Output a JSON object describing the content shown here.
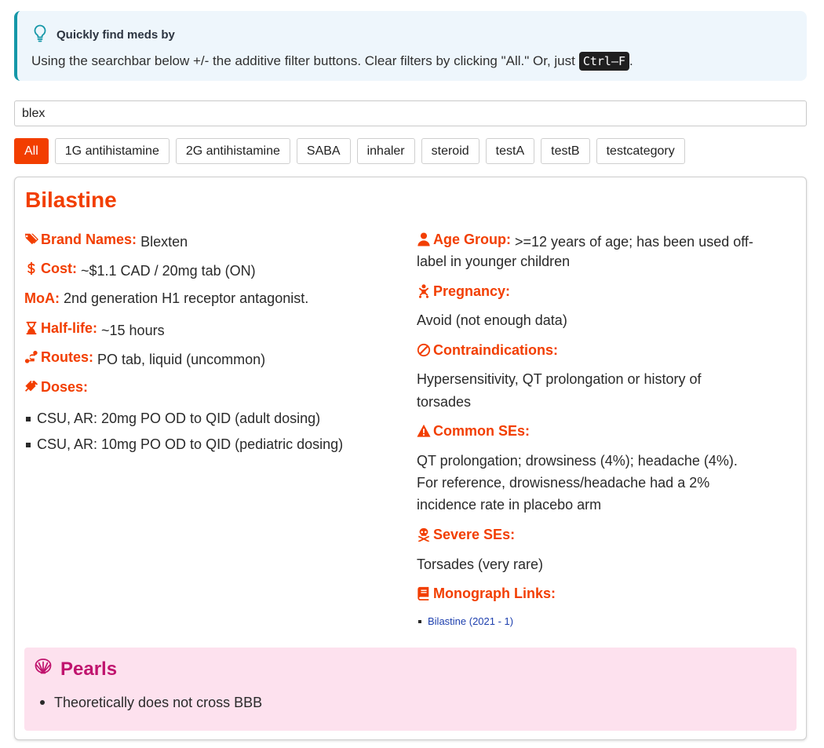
{
  "tip": {
    "title": "Quickly find meds by",
    "body": "Using the searchbar below +/- the additive filter buttons. Clear filters by clicking \"All.\" Or, just",
    "shortcut": "Ctrl–F",
    "end": ".",
    "accent": "#1597a8",
    "background": "#eef6fc"
  },
  "search": {
    "value": "blex"
  },
  "filters": [
    "All",
    "1G antihistamine",
    "2G antihistamine",
    "SABA",
    "inhaler",
    "steroid",
    "testA",
    "testB",
    "testcategory"
  ],
  "active_filter": "All",
  "drug": {
    "name": "Bilastine",
    "accent": "#f23e00",
    "brand_label": "Brand Names:",
    "brand_value": "Blexten",
    "cost_label": "Cost:",
    "cost_value": "~$1.1 CAD / 20mg tab (ON)",
    "moa_label": "MoA:",
    "moa_value": "2nd generation H1 receptor antagonist.",
    "halflife_label": "Half-life:",
    "halflife_value": "~15 hours",
    "routes_label": "Routes:",
    "routes_value": "PO tab, liquid (uncommon)",
    "doses_label": "Doses:",
    "doses": [
      "CSU, AR: 20mg PO OD to QID (adult dosing)",
      "CSU, AR: 10mg PO OD to QID (pediatric dosing)"
    ],
    "age_label": "Age Group:",
    "age_value_1": ">=12 years of age; has been used off-",
    "age_value_2": "label in younger children",
    "pregnancy_label": "Pregnancy:",
    "pregnancy_value": "Avoid (not enough data)",
    "contra_label": "Contraindications:",
    "contra_value_1": "Hypersensitivity, QT prolongation or history of",
    "contra_value_2": "torsades",
    "ses_label": "Common SEs:",
    "ses_value_1": "QT prolongation; drowsiness (4%); headache (4%).",
    "ses_value_2": "For reference, drowisness/headache had a 2%",
    "ses_value_3": "incidence rate in placebo arm",
    "severe_label": "Severe SEs:",
    "severe_value": "Torsades (very rare)",
    "links_label": "Monograph Links:",
    "links": [
      "Bilastine (2021 - 1)"
    ],
    "pearls_title": "Pearls",
    "pearls_color": "#c0146e",
    "pearls": [
      "Theoretically does not cross BBB"
    ]
  },
  "icons": {
    "tip": "lightbulb-icon",
    "brand": "tags-icon",
    "cost": "dollar-icon",
    "halflife": "hourglass-icon",
    "routes": "route-icon",
    "doses": "syringe-icon",
    "age": "user-icon",
    "pregnancy": "baby-icon",
    "contra": "ban-icon",
    "ses": "warning-icon",
    "severe": "skull-crossbones-icon",
    "links": "book-icon",
    "pearls": "shell-icon"
  }
}
